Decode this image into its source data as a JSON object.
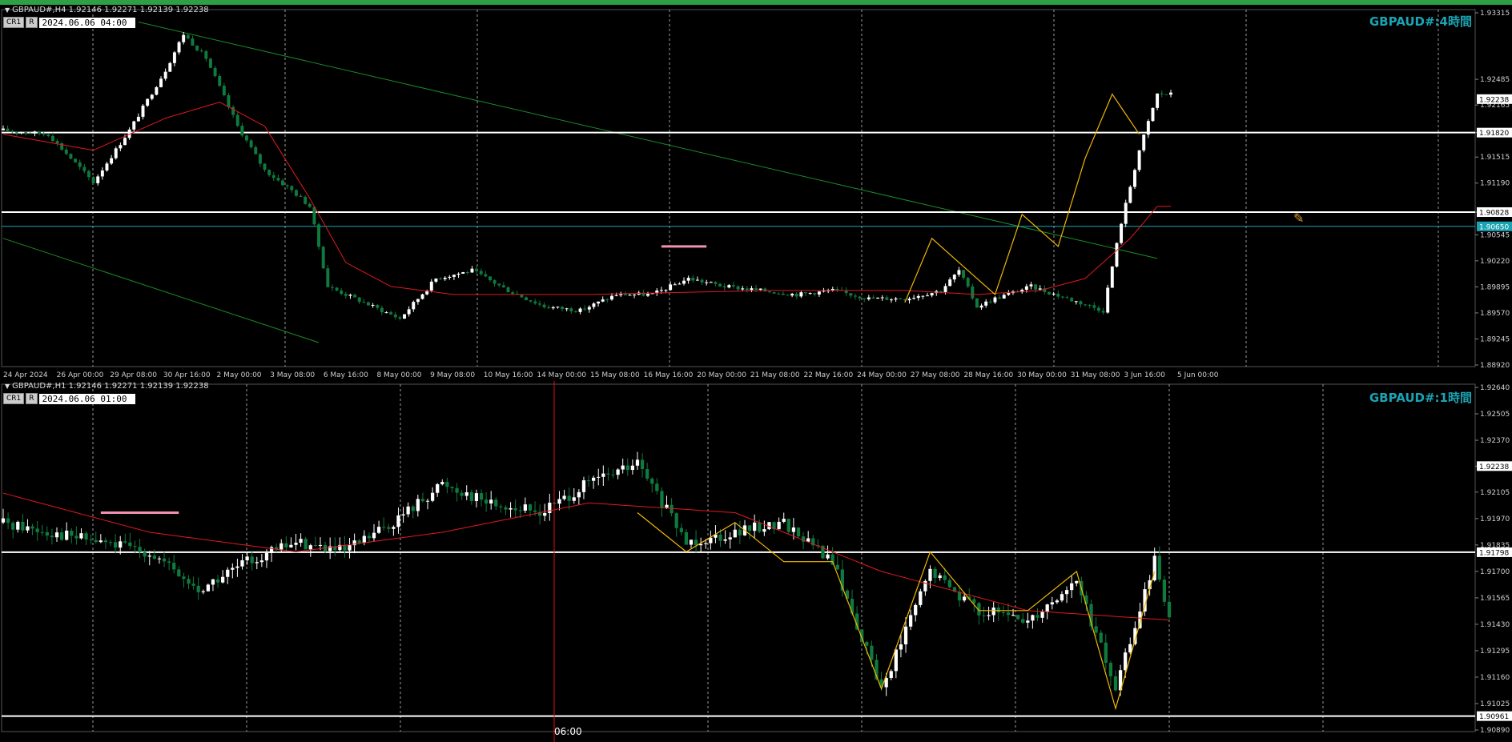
{
  "colors": {
    "background": "#000000",
    "bull_candle": "#ffffff",
    "bear_candle": "#0f7a3e",
    "ma_line": "#e0191f",
    "zigzag": "#f0b800",
    "trendline": "#1a8a2a",
    "title": "#1aa3b3",
    "top_bar": "#2ea043"
  },
  "pane1": {
    "info": "GBPAUD#,H4  1.92146 1.92271 1.92139 1.92238",
    "ctrl1": "CR1",
    "ctrl2": "R",
    "date_box": "2024.06.06 04:00",
    "title": "GBPAUD#:4時間",
    "edit_icon": "pencil-icon",
    "chart_data": {
      "type": "candlestick",
      "symbol": "GBPAUD#",
      "timeframe": "H4",
      "ohlc_last": {
        "open": 1.92146,
        "high": 1.92271,
        "low": 1.92139,
        "close": 1.92238
      },
      "ylim": [
        1.8892,
        1.93315
      ],
      "y_ticks": [
        1.93315,
        1.92485,
        1.92165,
        1.9182,
        1.91515,
        1.9119,
        1.90828,
        1.90545,
        1.9022,
        1.89895,
        1.8957,
        1.89245,
        1.8892
      ],
      "current_price": 1.92238,
      "current_price_label": "1.92238",
      "horizontal_lines": [
        {
          "price": 1.9182,
          "label": "1.91820",
          "color": "#ffffff"
        },
        {
          "price": 1.90828,
          "label": "1.90828",
          "color": "#ffffff"
        },
        {
          "price": 1.9065,
          "label": "1.90650",
          "color": "#1aa3b3"
        }
      ],
      "x_labels": [
        "24 Apr 2024",
        "26 Apr 00:00",
        "29 Apr 08:00",
        "30 Apr 16:00",
        "2 May 00:00",
        "3 May 08:00",
        "6 May 16:00",
        "8 May 00:00",
        "9 May 08:00",
        "10 May 16:00",
        "14 May 00:00",
        "15 May 08:00",
        "16 May 16:00",
        "20 May 00:00",
        "21 May 08:00",
        "22 May 16:00",
        "24 May 00:00",
        "27 May 08:00",
        "28 May 16:00",
        "30 May 00:00",
        "31 May 08:00",
        "3 Jun 16:00",
        "5 Jun 00:00"
      ],
      "bar_count": 260,
      "close_anchors": [
        [
          0,
          1.9185
        ],
        [
          10,
          1.918
        ],
        [
          20,
          1.912
        ],
        [
          28,
          1.9185
        ],
        [
          36,
          1.926
        ],
        [
          40,
          1.9305
        ],
        [
          45,
          1.9275
        ],
        [
          52,
          1.919
        ],
        [
          58,
          1.9135
        ],
        [
          64,
          1.911
        ],
        [
          68,
          1.909
        ],
        [
          72,
          1.899
        ],
        [
          80,
          1.897
        ],
        [
          88,
          1.895
        ],
        [
          96,
          1.9
        ],
        [
          104,
          1.901
        ],
        [
          112,
          1.8985
        ],
        [
          120,
          1.8965
        ],
        [
          128,
          1.896
        ],
        [
          136,
          1.898
        ],
        [
          144,
          1.898
        ],
        [
          152,
          1.9
        ],
        [
          160,
          1.899
        ],
        [
          168,
          1.8985
        ],
        [
          176,
          1.898
        ],
        [
          184,
          1.8985
        ],
        [
          192,
          1.8975
        ],
        [
          200,
          1.8975
        ],
        [
          208,
          1.8985
        ],
        [
          212,
          1.901
        ],
        [
          216,
          1.8965
        ],
        [
          220,
          1.8975
        ],
        [
          228,
          1.899
        ],
        [
          236,
          1.8975
        ],
        [
          244,
          1.896
        ],
        [
          248,
          1.907
        ],
        [
          252,
          1.916
        ],
        [
          256,
          1.923
        ]
      ],
      "ma_anchors": [
        [
          0,
          1.918
        ],
        [
          20,
          1.916
        ],
        [
          36,
          1.92
        ],
        [
          48,
          1.922
        ],
        [
          58,
          1.919
        ],
        [
          68,
          1.91
        ],
        [
          76,
          1.902
        ],
        [
          86,
          1.899
        ],
        [
          100,
          1.898
        ],
        [
          130,
          1.898
        ],
        [
          170,
          1.8985
        ],
        [
          200,
          1.8985
        ],
        [
          216,
          1.898
        ],
        [
          230,
          1.8985
        ],
        [
          240,
          1.9
        ],
        [
          250,
          1.905
        ],
        [
          256,
          1.909
        ]
      ],
      "zigzag_anchors": [
        [
          200,
          1.897
        ],
        [
          206,
          1.905
        ],
        [
          212,
          1.902
        ],
        [
          220,
          1.898
        ],
        [
          226,
          1.908
        ],
        [
          234,
          1.904
        ],
        [
          240,
          1.915
        ],
        [
          246,
          1.923
        ],
        [
          252,
          1.918
        ]
      ],
      "trendlines": [
        {
          "from": [
            30,
            1.932
          ],
          "to": [
            256,
            1.9025
          ]
        },
        {
          "from": [
            0,
            1.905
          ],
          "to": [
            70,
            1.892
          ]
        }
      ],
      "highlight_segments": [
        {
          "from": [
            146,
            1.904
          ],
          "to": [
            156,
            1.904
          ],
          "color": "#f48fb1"
        }
      ]
    }
  },
  "pane2": {
    "info": "GBPAUD#,H1  1.92146 1.92271 1.92139 1.92238",
    "ctrl1": "CR1",
    "ctrl2": "R",
    "date_box": "2024.06.06 01:00",
    "title": "GBPAUD#:1時間",
    "crosshair_label": "06:00",
    "chart_data": {
      "type": "candlestick",
      "symbol": "GBPAUD#",
      "timeframe": "H1",
      "ohlc_last": {
        "open": 1.92146,
        "high": 1.92271,
        "low": 1.92139,
        "close": 1.92238
      },
      "ylim": [
        1.9089,
        1.9264
      ],
      "y_ticks": [
        1.9264,
        1.92505,
        1.9237,
        1.92238,
        1.92105,
        1.9197,
        1.91835,
        1.917,
        1.91565,
        1.9143,
        1.91295,
        1.9116,
        1.91025,
        1.9089
      ],
      "current_price": 1.92238,
      "current_price_label": "1.92238",
      "horizontal_lines": [
        {
          "price": 1.91798,
          "label": "1.91798",
          "color": "#ffffff"
        },
        {
          "price": 1.90961,
          "label": "1.90961",
          "color": "#ffffff"
        }
      ],
      "bar_count": 240,
      "close_anchors": [
        [
          0,
          1.9195
        ],
        [
          10,
          1.919
        ],
        [
          20,
          1.9185
        ],
        [
          30,
          1.918
        ],
        [
          40,
          1.916
        ],
        [
          50,
          1.9175
        ],
        [
          60,
          1.9185
        ],
        [
          70,
          1.918
        ],
        [
          80,
          1.9195
        ],
        [
          90,
          1.9215
        ],
        [
          100,
          1.9205
        ],
        [
          110,
          1.92
        ],
        [
          120,
          1.9215
        ],
        [
          130,
          1.9225
        ],
        [
          140,
          1.9185
        ],
        [
          150,
          1.919
        ],
        [
          160,
          1.9195
        ],
        [
          170,
          1.9175
        ],
        [
          180,
          1.911
        ],
        [
          190,
          1.917
        ],
        [
          200,
          1.915
        ],
        [
          210,
          1.9145
        ],
        [
          220,
          1.9165
        ],
        [
          228,
          1.911
        ],
        [
          236,
          1.9175
        ],
        [
          240,
          1.914
        ]
      ],
      "ma_anchors": [
        [
          0,
          1.921
        ],
        [
          30,
          1.919
        ],
        [
          60,
          1.918
        ],
        [
          90,
          1.919
        ],
        [
          120,
          1.9205
        ],
        [
          150,
          1.92
        ],
        [
          180,
          1.917
        ],
        [
          210,
          1.915
        ],
        [
          240,
          1.9145
        ]
      ],
      "zigzag_anchors": [
        [
          130,
          1.92
        ],
        [
          140,
          1.918
        ],
        [
          150,
          1.9195
        ],
        [
          160,
          1.9175
        ],
        [
          170,
          1.9175
        ],
        [
          180,
          1.911
        ],
        [
          190,
          1.918
        ],
        [
          200,
          1.915
        ],
        [
          210,
          1.915
        ],
        [
          220,
          1.917
        ],
        [
          228,
          1.91
        ],
        [
          236,
          1.917
        ]
      ],
      "highlight_segments": [
        {
          "from": [
            20,
            1.92
          ],
          "to": [
            36,
            1.92
          ],
          "color": "#f48fb1"
        }
      ]
    }
  }
}
